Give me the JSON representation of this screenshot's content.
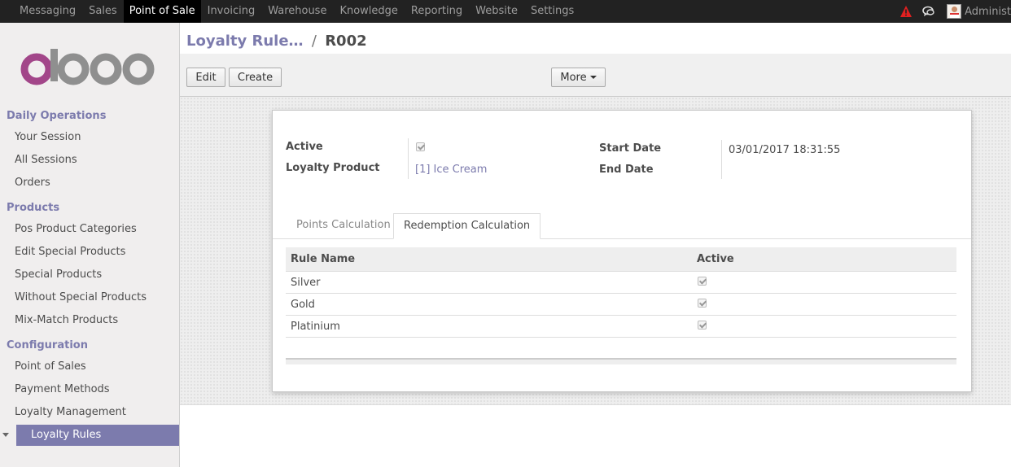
{
  "nav": {
    "items": [
      "Messaging",
      "Sales",
      "Point of Sale",
      "Invoicing",
      "Warehouse",
      "Knowledge",
      "Reporting",
      "Website",
      "Settings"
    ],
    "active": "Point of Sale",
    "user": "Administ"
  },
  "sidebar": {
    "sections": [
      {
        "title": "Daily Operations",
        "items": [
          "Your Session",
          "All Sessions",
          "Orders"
        ]
      },
      {
        "title": "Products",
        "items": [
          "Pos Product Categories",
          "Edit Special Products",
          "Special Products",
          "Without Special Products",
          "Mix-Match Products"
        ]
      },
      {
        "title": "Configuration",
        "items": [
          "Point of Sales",
          "Payment Methods",
          "Loyalty Management",
          "Loyalty Rules"
        ]
      }
    ],
    "active_item": "Loyalty Rules"
  },
  "breadcrumb": {
    "parent": "Loyalty Rule…",
    "separator": "/",
    "current": "R002"
  },
  "toolbar": {
    "edit": "Edit",
    "create": "Create",
    "more": "More"
  },
  "form": {
    "active_label": "Active",
    "active_value": true,
    "product_label": "Loyalty Product",
    "product_value": "[1] Ice Cream",
    "start_label": "Start Date",
    "start_value": "03/01/2017 18:31:55",
    "end_label": "End Date",
    "end_value": ""
  },
  "tabs": {
    "points": "Points Calculation",
    "redemption": "Redemption Calculation",
    "active": "Redemption Calculation"
  },
  "table": {
    "headers": [
      "Rule Name",
      "Active"
    ],
    "rows": [
      {
        "name": "Silver",
        "active": true
      },
      {
        "name": "Gold",
        "active": true
      },
      {
        "name": "Platinium",
        "active": true
      }
    ]
  },
  "colors": {
    "brand": "#7c7bad",
    "navbar": "#222222",
    "alert": "#e02020"
  }
}
